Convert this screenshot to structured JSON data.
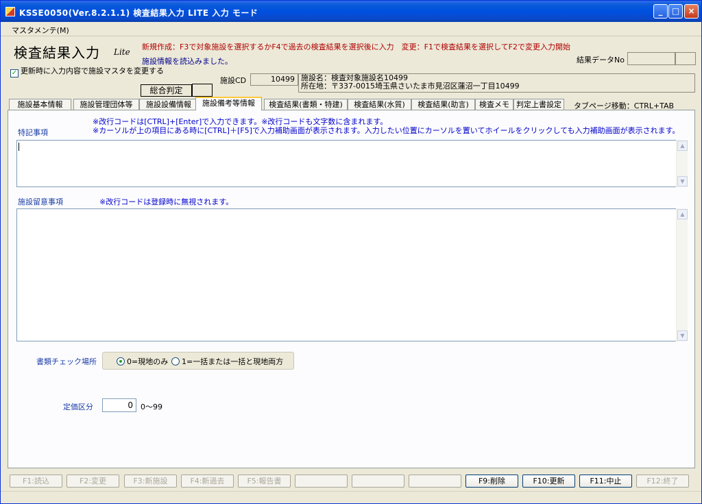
{
  "window": {
    "title": "KSSE0050(Ver.8.2.1.1) 検査結果入力 LITE 入力 モード",
    "minimize": "_",
    "maximize": "□",
    "close": "×"
  },
  "menu": {
    "maintenance": "マスタメンテ(M)"
  },
  "header": {
    "title": "検査結果入力",
    "lite": "Lite",
    "instruction": "新規作成：F3で対象施設を選択するかF4で過去の検査結果を選択後に入力　変更：F1で検査結果を選択してF2で変更入力開始",
    "status_message": "施設情報を読込みました。",
    "result_no_label": "結果データNo",
    "update_master_checkbox": {
      "label": "更新時に入力内容で施設マスタを変更する",
      "checked": true,
      "mark": "✓"
    },
    "facility_cd_label": "施設CD",
    "facility_cd": "10499",
    "facility_name": "施設名：検査対象施設名10499",
    "facility_address": "所在地：〒337-0015埼玉県さいたま市見沼区蓮沼一丁目10499",
    "overall_judgment_label": "総合判定"
  },
  "tabs": [
    {
      "label": "施設基本情報",
      "active": false
    },
    {
      "label": "施設管理団体等",
      "active": false
    },
    {
      "label": "施設設備情報",
      "active": false
    },
    {
      "label": "施設備考等情報",
      "active": true
    },
    {
      "label": "検査結果(書類・特建)",
      "active": false
    },
    {
      "label": "検査結果(水質)",
      "active": false
    },
    {
      "label": "検査結果(助言)",
      "active": false
    },
    {
      "label": "検査メモ",
      "active": false
    },
    {
      "label": "判定上書設定",
      "active": false
    }
  ],
  "tab_hint": "タブページ移動：CTRL+TAB",
  "panel": {
    "note1": "※改行コードは[CTRL]+[Enter]で入力できます。※改行コードも文字数に含まれます。",
    "note2": "※カーソルが上の項目にある時に[CTRL]＋[F5]で入力補助画面が表示されます。入力したい位置にカーソルを置いてホイールをクリックしても入力補助画面が表示されます。",
    "special_notes_label": "特記事項",
    "special_notes_value": "",
    "facility_notes_label": "施設留意事項",
    "facility_notes_note": "※改行コードは登録時に無視されます。",
    "facility_notes_value": "",
    "doc_check_label": "書類チェック場所",
    "doc_check_options": [
      {
        "label": "0=現地のみ",
        "checked": true
      },
      {
        "label": "1=一括または一括と現地両方",
        "checked": false
      }
    ],
    "price_label": "定価区分",
    "price_value": "0",
    "price_range": "0～99"
  },
  "function_keys": [
    {
      "label": "F1:読込",
      "enabled": false
    },
    {
      "label": "F2:変更",
      "enabled": false
    },
    {
      "label": "F3:新施設",
      "enabled": false
    },
    {
      "label": "F4:新過去",
      "enabled": false
    },
    {
      "label": "F5:報告書",
      "enabled": false
    },
    {
      "label": "",
      "enabled": false
    },
    {
      "label": "",
      "enabled": false
    },
    {
      "label": "",
      "enabled": false
    },
    {
      "label": "F9:削除",
      "enabled": true
    },
    {
      "label": "F10:更新",
      "enabled": true
    },
    {
      "label": "F11:中止",
      "enabled": true
    },
    {
      "label": "F12:終了",
      "enabled": false
    }
  ]
}
